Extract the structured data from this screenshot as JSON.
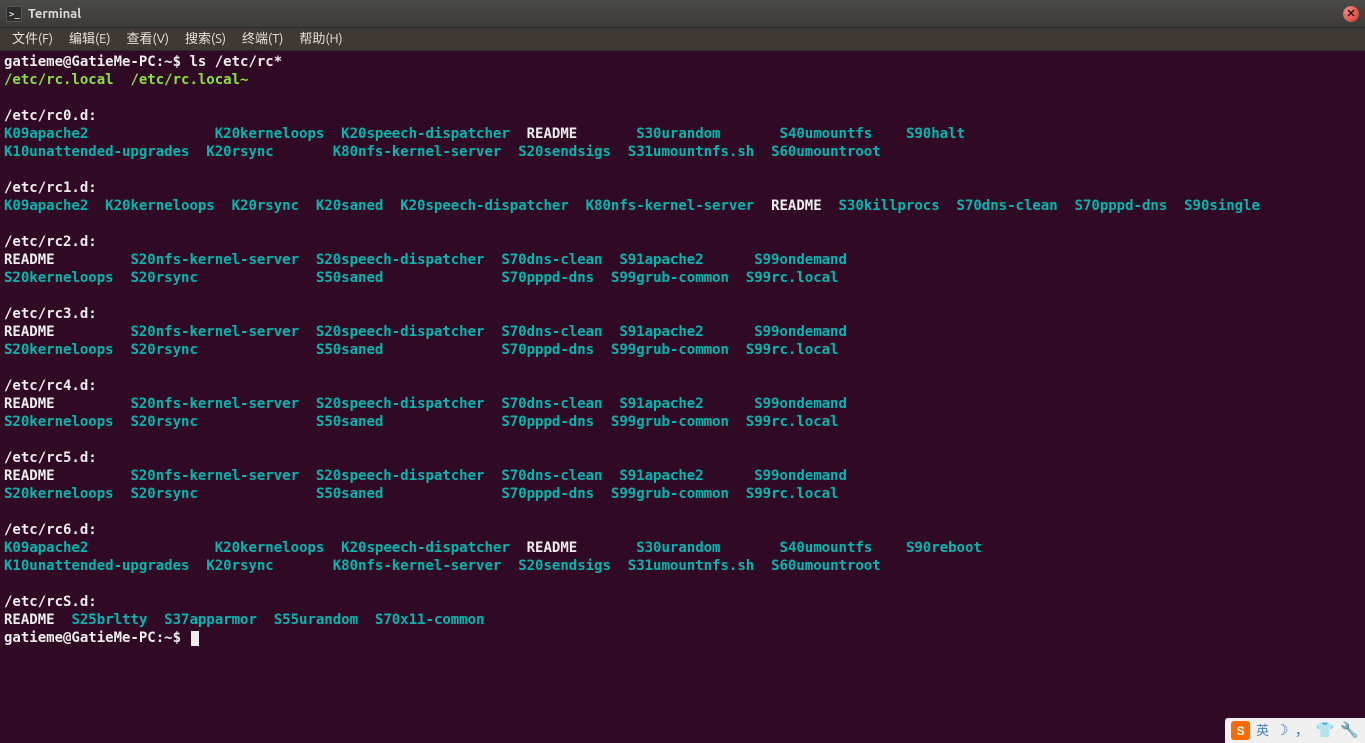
{
  "window": {
    "title": "Terminal"
  },
  "menu": {
    "file": "文件(F)",
    "edit": "编辑(E)",
    "view": "查看(V)",
    "search": "搜索(S)",
    "term": "终端(T)",
    "help": "帮助(H)"
  },
  "prompt": {
    "user": "gatieme@GatieMe-PC",
    "sep1": ":",
    "path": "~",
    "sep2": "$ "
  },
  "command": "ls /etc/rc*",
  "files_green": {
    "rc_local": "/etc/rc.local",
    "rc_localb": "/etc/rc.local~"
  },
  "dirs": {
    "rc0": "/etc/rc0.d:",
    "rc1": "/etc/rc1.d:",
    "rc2": "/etc/rc2.d:",
    "rc3": "/etc/rc3.d:",
    "rc4": "/etc/rc4.d:",
    "rc5": "/etc/rc5.d:",
    "rc6": "/etc/rc6.d:",
    "rcS": "/etc/rcS.d:"
  },
  "rc0": {
    "r1": {
      "a": "K09apache2",
      "b": "K20kerneloops",
      "c": "K20speech-dispatcher",
      "d": "README",
      "e": "S30urandom",
      "f": "S40umountfs",
      "g": "S90halt"
    },
    "r2": {
      "a": "K10unattended-upgrades",
      "b": "K20rsync",
      "c": "K80nfs-kernel-server",
      "d": "S20sendsigs",
      "e": "S31umountnfs.sh",
      "f": "S60umountroot"
    }
  },
  "rc1": {
    "a": "K09apache2",
    "b": "K20kerneloops",
    "c": "K20rsync",
    "d": "K20saned",
    "e": "K20speech-dispatcher",
    "f": "K80nfs-kernel-server",
    "g": "README",
    "h": "S30killprocs",
    "i": "S70dns-clean",
    "j": "S70pppd-dns",
    "k": "S90single"
  },
  "rc2": {
    "r1": {
      "a": "README",
      "b": "S20nfs-kernel-server",
      "c": "S20speech-dispatcher",
      "d": "S70dns-clean",
      "e": "S91apache2",
      "f": "S99ondemand"
    },
    "r2": {
      "a": "S20kerneloops",
      "b": "S20rsync",
      "c": "S50saned",
      "d": "S70pppd-dns",
      "e": "S99grub-common",
      "f": "S99rc.local"
    }
  },
  "rc3": {
    "r1": {
      "a": "README",
      "b": "S20nfs-kernel-server",
      "c": "S20speech-dispatcher",
      "d": "S70dns-clean",
      "e": "S91apache2",
      "f": "S99ondemand"
    },
    "r2": {
      "a": "S20kerneloops",
      "b": "S20rsync",
      "c": "S50saned",
      "d": "S70pppd-dns",
      "e": "S99grub-common",
      "f": "S99rc.local"
    }
  },
  "rc4": {
    "r1": {
      "a": "README",
      "b": "S20nfs-kernel-server",
      "c": "S20speech-dispatcher",
      "d": "S70dns-clean",
      "e": "S91apache2",
      "f": "S99ondemand"
    },
    "r2": {
      "a": "S20kerneloops",
      "b": "S20rsync",
      "c": "S50saned",
      "d": "S70pppd-dns",
      "e": "S99grub-common",
      "f": "S99rc.local"
    }
  },
  "rc5": {
    "r1": {
      "a": "README",
      "b": "S20nfs-kernel-server",
      "c": "S20speech-dispatcher",
      "d": "S70dns-clean",
      "e": "S91apache2",
      "f": "S99ondemand"
    },
    "r2": {
      "a": "S20kerneloops",
      "b": "S20rsync",
      "c": "S50saned",
      "d": "S70pppd-dns",
      "e": "S99grub-common",
      "f": "S99rc.local"
    }
  },
  "rc6": {
    "r1": {
      "a": "K09apache2",
      "b": "K20kerneloops",
      "c": "K20speech-dispatcher",
      "d": "README",
      "e": "S30urandom",
      "f": "S40umountfs",
      "g": "S90reboot"
    },
    "r2": {
      "a": "K10unattended-upgrades",
      "b": "K20rsync",
      "c": "K80nfs-kernel-server",
      "d": "S20sendsigs",
      "e": "S31umountnfs.sh",
      "f": "S60umountroot"
    }
  },
  "rcS": {
    "a": "README",
    "b": "S25brltty",
    "c": "S37apparmor",
    "d": "S55urandom",
    "e": "S70x11-common"
  },
  "tray": {
    "badge": "S",
    "ime": "英"
  }
}
